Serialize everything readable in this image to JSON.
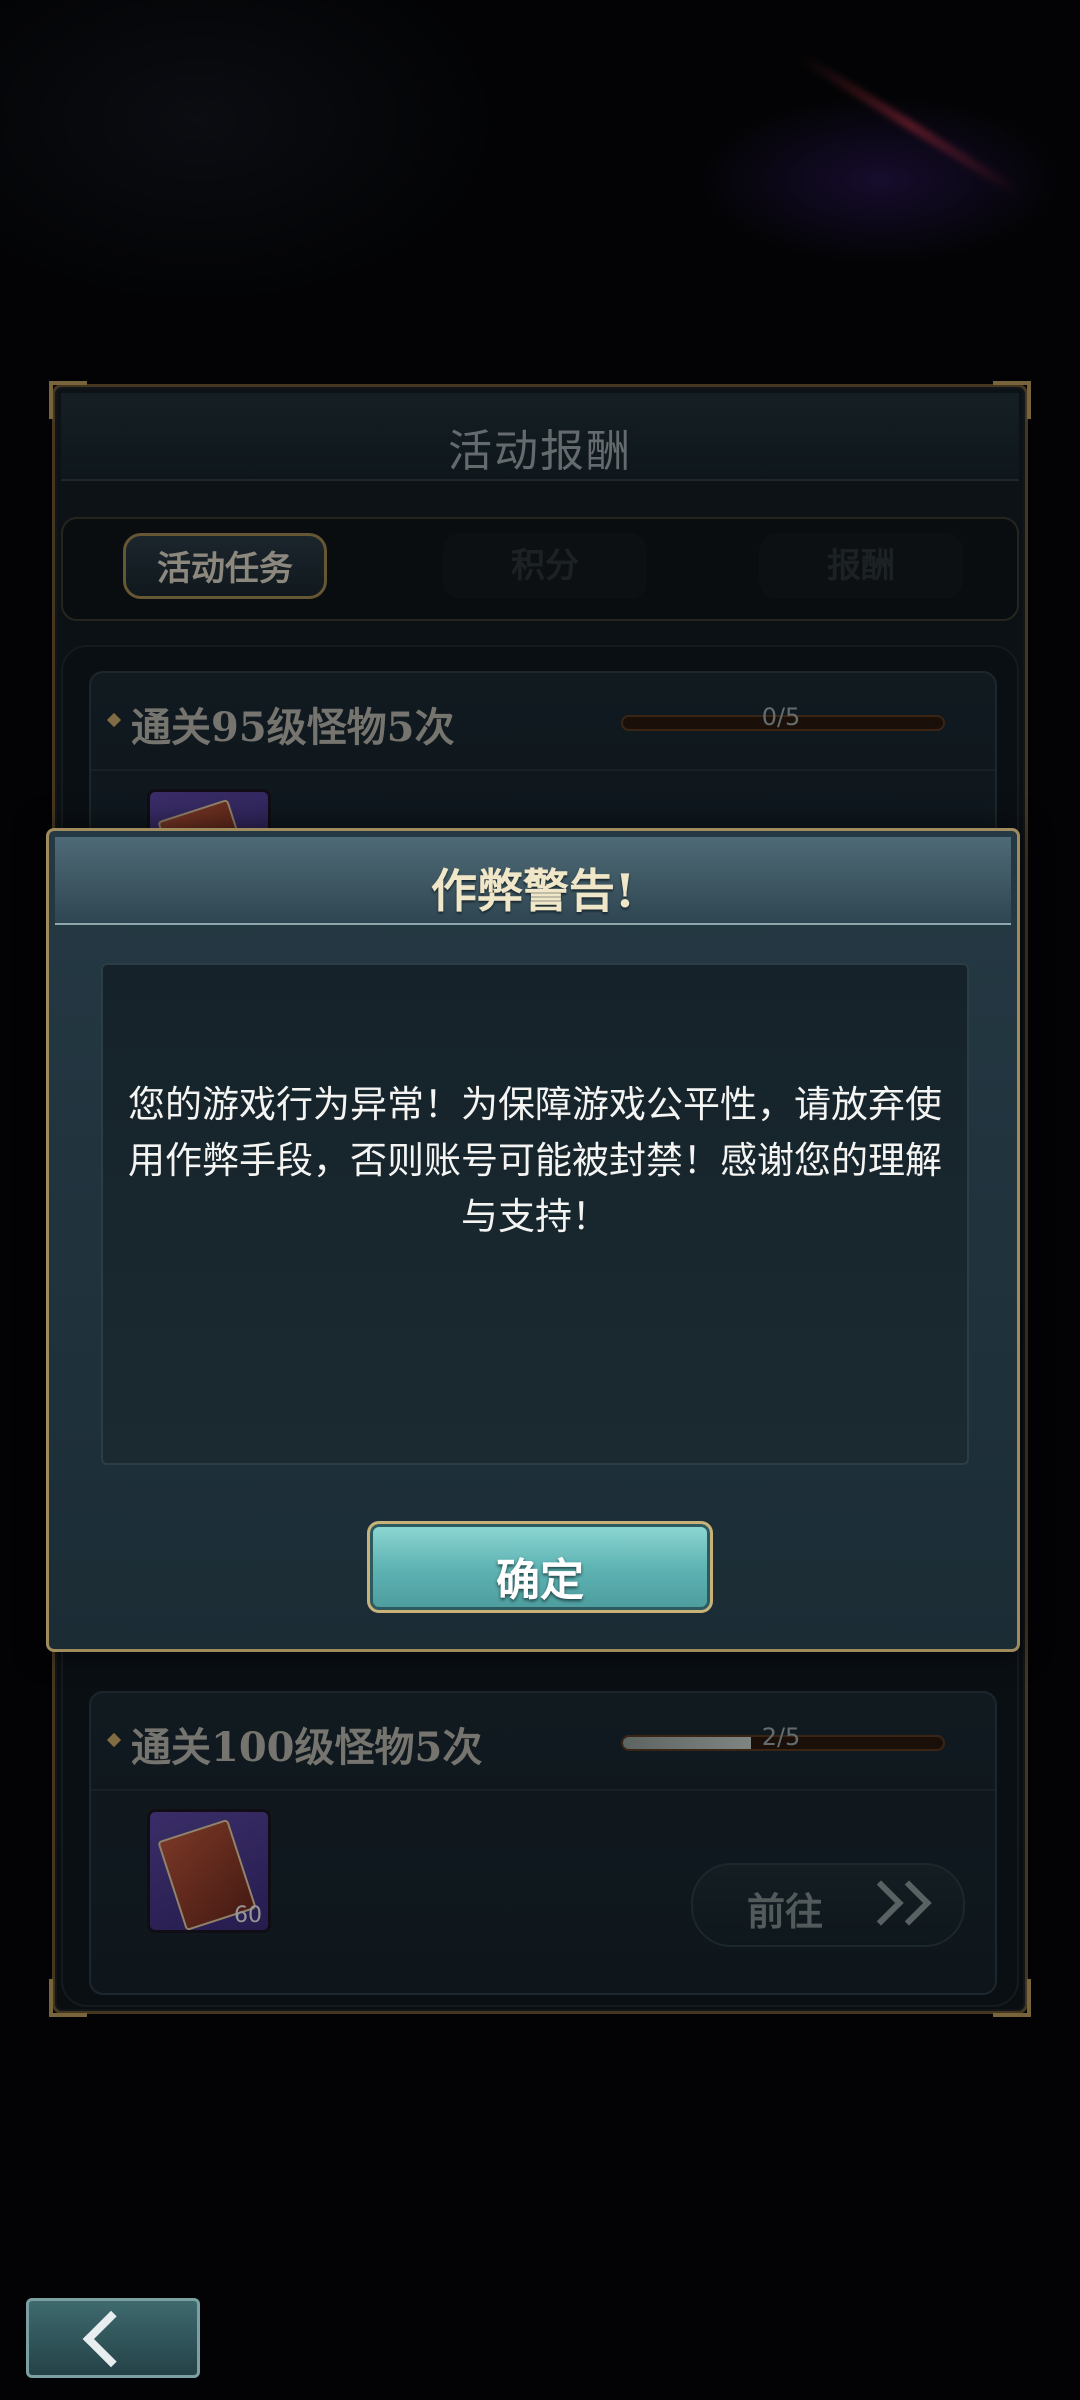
{
  "panel": {
    "title": "活动报酬",
    "tabs": [
      {
        "label": "活动任务",
        "active": true
      },
      {
        "label": "积分",
        "active": false
      },
      {
        "label": "报酬",
        "active": false
      }
    ],
    "tasks": [
      {
        "title": "通关95级怪物5次",
        "progress_text": "0/5",
        "progress": 0.0
      },
      {
        "title": "通关100级怪物5次",
        "progress_text": "2/5",
        "progress": 0.4,
        "reward_count": "60",
        "action_label": "前往"
      }
    ]
  },
  "dialog": {
    "title": "作弊警告!",
    "message": "您的游戏行为异常！为保障游戏公平性，请放弃使用作弊手段，否则账号可能被封禁！感谢您的理解与支持！",
    "confirm_label": "确定"
  },
  "icons": {
    "back": "back-arrow-icon",
    "go": "double-chevron-right-icon",
    "reward": "book-item-icon"
  },
  "colors": {
    "accent_gold": "#a08b5c",
    "confirm_teal": "#5fb4b4",
    "dialog_bg": "#1b2c35"
  }
}
